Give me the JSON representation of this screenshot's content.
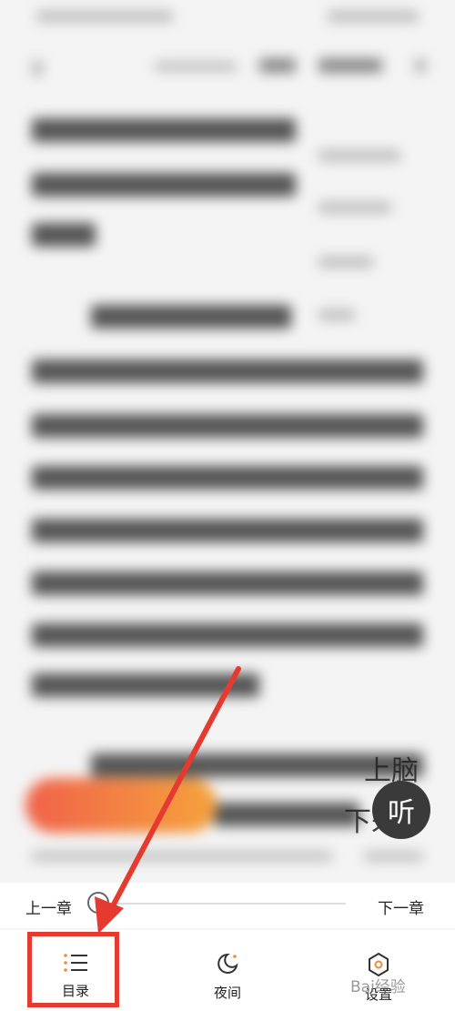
{
  "listen_label": "听",
  "side_text_1": "上脑",
  "side_text_2": "下来.",
  "prev_chapter": "上一章",
  "next_chapter": "下一章",
  "tabs": {
    "catalog": "目录",
    "night": "夜间",
    "settings": "设置"
  },
  "progress_percent": 0,
  "annotation_color": "#e53a2f",
  "accent_color": "#f08a3c",
  "watermark": "Bai经验"
}
